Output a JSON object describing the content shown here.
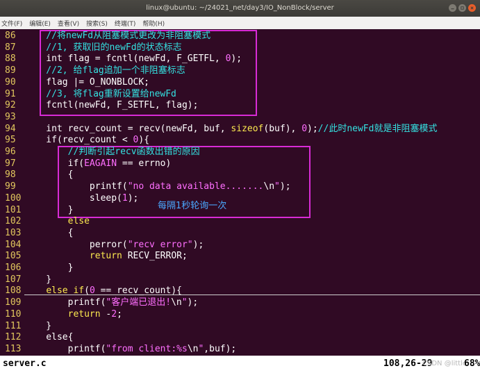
{
  "window": {
    "title": "linux@ubuntu: ~/24021_net/day3/IO_NonBlock/server"
  },
  "menu": [
    "文件(F)",
    "编辑(E)",
    "查看(V)",
    "搜索(S)",
    "终端(T)",
    "帮助(H)"
  ],
  "code_lines": [
    {
      "num": "86",
      "segments": [
        {
          "t": "    //将newFd从阻塞模式更改为非阻塞模式",
          "c": "#34e2e2"
        }
      ]
    },
    {
      "num": "87",
      "segments": [
        {
          "t": "    //1, 获取旧的newFd的状态标志",
          "c": "#34e2e2"
        }
      ]
    },
    {
      "num": "88",
      "segments": [
        {
          "t": "    int flag = fcntl(newFd, F_GETFL, ",
          "c": "#ffffff"
        },
        {
          "t": "0",
          "c": "#ff6fff"
        },
        {
          "t": ");",
          "c": "#ffffff"
        }
      ]
    },
    {
      "num": "89",
      "segments": [
        {
          "t": "    //2, 给flag追加一个非阻塞标志",
          "c": "#34e2e2"
        }
      ]
    },
    {
      "num": "90",
      "segments": [
        {
          "t": "    flag |= O_NONBLOCK;",
          "c": "#ffffff"
        }
      ]
    },
    {
      "num": "91",
      "segments": [
        {
          "t": "    //3, 将flag重新设置给newFd",
          "c": "#34e2e2"
        }
      ]
    },
    {
      "num": "92",
      "segments": [
        {
          "t": "    fcntl(newFd, F_SETFL, flag);",
          "c": "#ffffff"
        }
      ]
    },
    {
      "num": "93",
      "segments": []
    },
    {
      "num": "94",
      "segments": [
        {
          "t": "    int recv_count = recv(newFd, buf, ",
          "c": "#ffffff"
        },
        {
          "t": "sizeof",
          "c": "#fce94f"
        },
        {
          "t": "(buf), ",
          "c": "#ffffff"
        },
        {
          "t": "0",
          "c": "#ff6fff"
        },
        {
          "t": ");",
          "c": "#ffffff"
        },
        {
          "t": "//此时newFd就是非阻塞模式",
          "c": "#34e2e2"
        }
      ]
    },
    {
      "num": "95",
      "segments": [
        {
          "t": "    if(recv_count < ",
          "c": "#ffffff"
        },
        {
          "t": "0",
          "c": "#ff6fff"
        },
        {
          "t": "){",
          "c": "#ffffff"
        }
      ]
    },
    {
      "num": "96",
      "segments": [
        {
          "t": "        //判断引起recv函数出错的原因",
          "c": "#34e2e2"
        }
      ]
    },
    {
      "num": "97",
      "segments": [
        {
          "t": "        if(",
          "c": "#ffffff"
        },
        {
          "t": "EAGAIN",
          "c": "#ff6fff"
        },
        {
          "t": " == errno)",
          "c": "#ffffff"
        }
      ]
    },
    {
      "num": "98",
      "segments": [
        {
          "t": "        {",
          "c": "#ffffff"
        }
      ]
    },
    {
      "num": "99",
      "segments": [
        {
          "t": "            printf(",
          "c": "#ffffff"
        },
        {
          "t": "\"no data available.......",
          "c": "#ff6fff"
        },
        {
          "t": "\\n",
          "c": "#ffffff"
        },
        {
          "t": "\"",
          "c": "#ff6fff"
        },
        {
          "t": ");",
          "c": "#ffffff"
        }
      ]
    },
    {
      "num": "100",
      "segments": [
        {
          "t": "            sleep(",
          "c": "#ffffff"
        },
        {
          "t": "1",
          "c": "#ff6fff"
        },
        {
          "t": ");",
          "c": "#ffffff"
        }
      ]
    },
    {
      "num": "101",
      "segments": [
        {
          "t": "        }",
          "c": "#ffffff"
        }
      ]
    },
    {
      "num": "102",
      "segments": [
        {
          "t": "        else",
          "c": "#fce94f"
        }
      ]
    },
    {
      "num": "103",
      "segments": [
        {
          "t": "        {",
          "c": "#ffffff"
        }
      ]
    },
    {
      "num": "104",
      "segments": [
        {
          "t": "            perror(",
          "c": "#ffffff"
        },
        {
          "t": "\"recv error\"",
          "c": "#ff6fff"
        },
        {
          "t": ");",
          "c": "#ffffff"
        }
      ]
    },
    {
      "num": "105",
      "segments": [
        {
          "t": "            ",
          "c": "#ffffff"
        },
        {
          "t": "return",
          "c": "#fce94f"
        },
        {
          "t": " RECV_ERROR;",
          "c": "#ffffff"
        }
      ]
    },
    {
      "num": "106",
      "segments": [
        {
          "t": "        }",
          "c": "#ffffff"
        }
      ]
    },
    {
      "num": "107",
      "segments": [
        {
          "t": "    }",
          "c": "#ffffff"
        }
      ]
    },
    {
      "num": "108",
      "segments": [
        {
          "t": "    ",
          "c": "#ffffff"
        },
        {
          "t": "else if",
          "c": "#fce94f"
        },
        {
          "t": "(",
          "c": "#ffffff"
        },
        {
          "t": "0",
          "c": "#ff6fff"
        },
        {
          "t": " == recv_count){",
          "c": "#ffffff"
        }
      ]
    },
    {
      "num": "109",
      "segments": [
        {
          "t": "        printf(",
          "c": "#ffffff"
        },
        {
          "t": "\"客户端已退出!",
          "c": "#ff6fff"
        },
        {
          "t": "\\n",
          "c": "#ffffff"
        },
        {
          "t": "\"",
          "c": "#ff6fff"
        },
        {
          "t": ");",
          "c": "#ffffff"
        }
      ]
    },
    {
      "num": "110",
      "segments": [
        {
          "t": "        ",
          "c": "#ffffff"
        },
        {
          "t": "return",
          "c": "#fce94f"
        },
        {
          "t": " -",
          "c": "#ffffff"
        },
        {
          "t": "2",
          "c": "#ff6fff"
        },
        {
          "t": ";",
          "c": "#ffffff"
        }
      ]
    },
    {
      "num": "111",
      "segments": [
        {
          "t": "    }",
          "c": "#ffffff"
        }
      ]
    },
    {
      "num": "112",
      "segments": [
        {
          "t": "    else{",
          "c": "#ffffff"
        }
      ]
    },
    {
      "num": "113",
      "segments": [
        {
          "t": "        printf(",
          "c": "#ffffff"
        },
        {
          "t": "\"from client:%s",
          "c": "#ff6fff"
        },
        {
          "t": "\\n",
          "c": "#ffffff"
        },
        {
          "t": "\"",
          "c": "#ff6fff"
        },
        {
          "t": ",buf);",
          "c": "#ffffff"
        }
      ]
    }
  ],
  "annotation": "每隔1秒轮询一次",
  "status": {
    "filename": "server.c",
    "position": "108,26-29",
    "percent": "68%",
    "watermark": "CSDN @little"
  }
}
